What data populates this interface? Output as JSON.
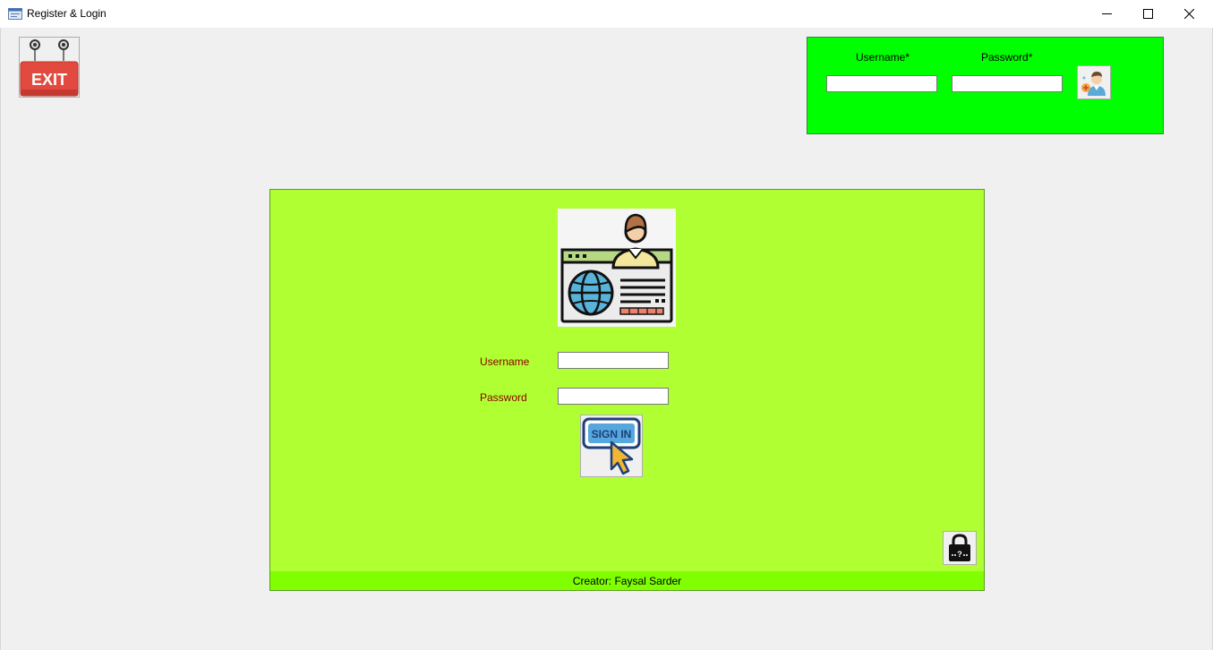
{
  "window": {
    "title": "Register & Login",
    "controls": [
      "minimize-icon",
      "maximize-icon",
      "close-icon"
    ]
  },
  "exit_button": {
    "label": "EXIT",
    "icon": "exit-sign-icon"
  },
  "register": {
    "username_label": "Username*",
    "password_label": "Password*",
    "username_value": "",
    "password_value": "",
    "button_icon": "add-user-icon",
    "background": "#00ff00"
  },
  "login": {
    "hero_icon": "web-profile-icon",
    "username_label": "Username",
    "password_label": "Password",
    "username_value": "",
    "password_value": "",
    "signin_label": "SIGN IN",
    "forgot_icon": "lock-question-icon",
    "background": "#b0ff33",
    "label_color": "#8b0000"
  },
  "footer": {
    "text": "Creator: Faysal Sarder",
    "background": "#7fff00"
  }
}
